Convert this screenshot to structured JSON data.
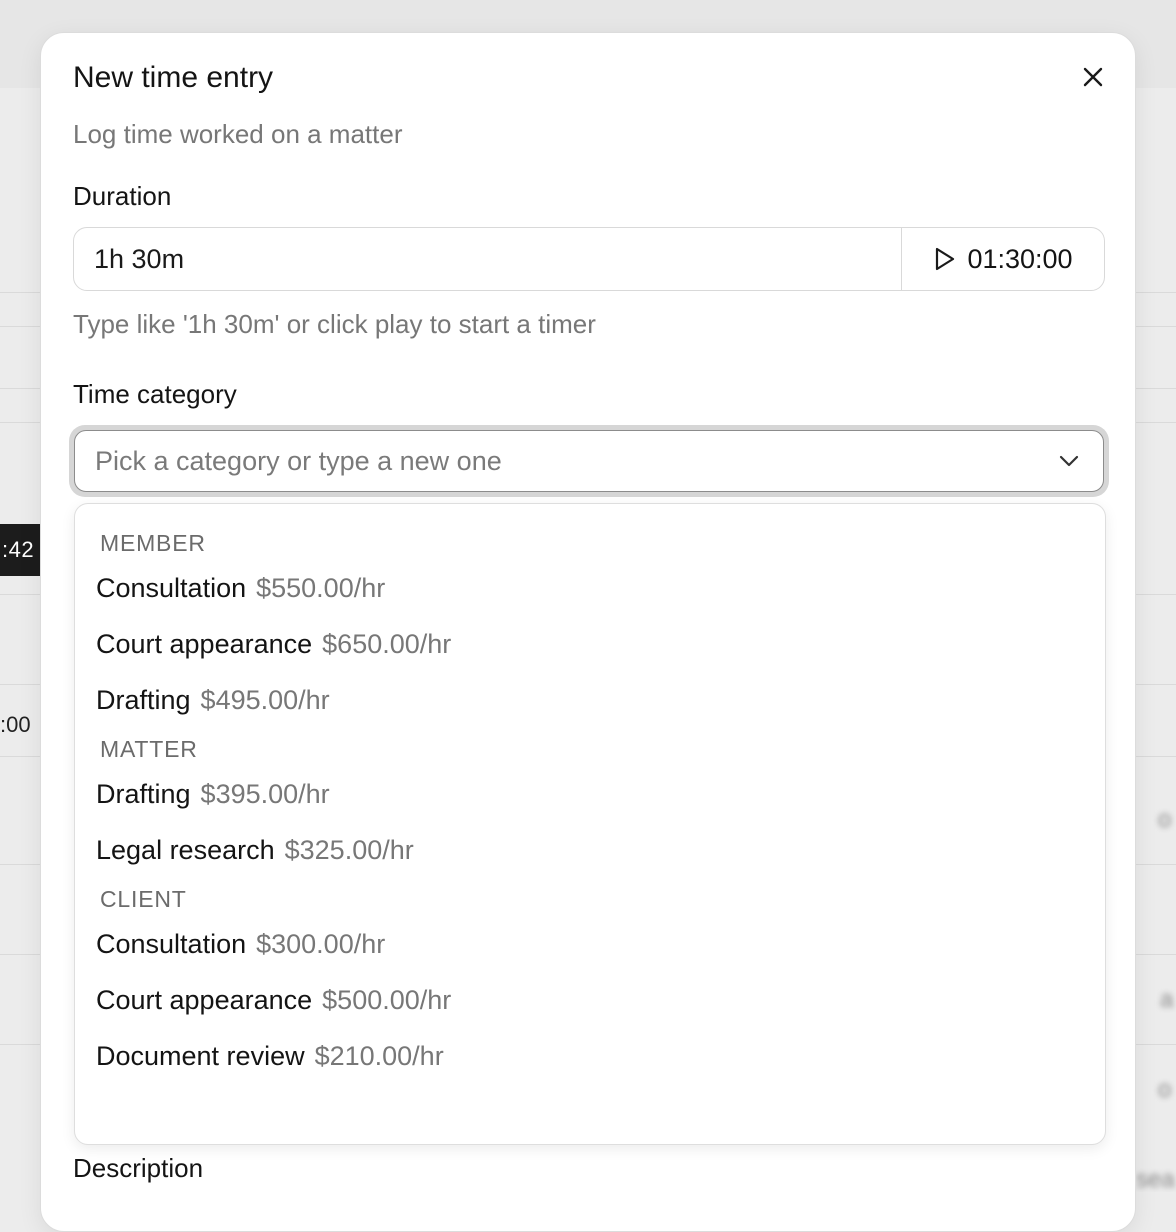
{
  "background": {
    "chip_text": ":42",
    "time_text": ":00",
    "blur_fragments": [
      "o",
      "a",
      "o",
      "sea"
    ]
  },
  "modal": {
    "title": "New time entry",
    "subtitle": "Log time worked on a matter",
    "duration": {
      "label": "Duration",
      "value": "1h 30m",
      "timer_display": "01:30:00",
      "hint": "Type like '1h 30m' or click play to start a timer"
    },
    "time_category": {
      "label": "Time category",
      "placeholder": "Pick a category or type a new one",
      "groups": [
        {
          "heading": "MEMBER",
          "options": [
            {
              "name": "Consultation",
              "rate": "$550.00/hr"
            },
            {
              "name": "Court appearance",
              "rate": "$650.00/hr"
            },
            {
              "name": "Drafting",
              "rate": "$495.00/hr"
            }
          ]
        },
        {
          "heading": "MATTER",
          "options": [
            {
              "name": "Drafting",
              "rate": "$395.00/hr"
            },
            {
              "name": "Legal research",
              "rate": "$325.00/hr"
            }
          ]
        },
        {
          "heading": "CLIENT",
          "options": [
            {
              "name": "Consultation",
              "rate": "$300.00/hr"
            },
            {
              "name": "Court appearance",
              "rate": "$500.00/hr"
            },
            {
              "name": "Document review",
              "rate": "$210.00/hr"
            }
          ]
        }
      ]
    },
    "description": {
      "label": "Description"
    }
  }
}
